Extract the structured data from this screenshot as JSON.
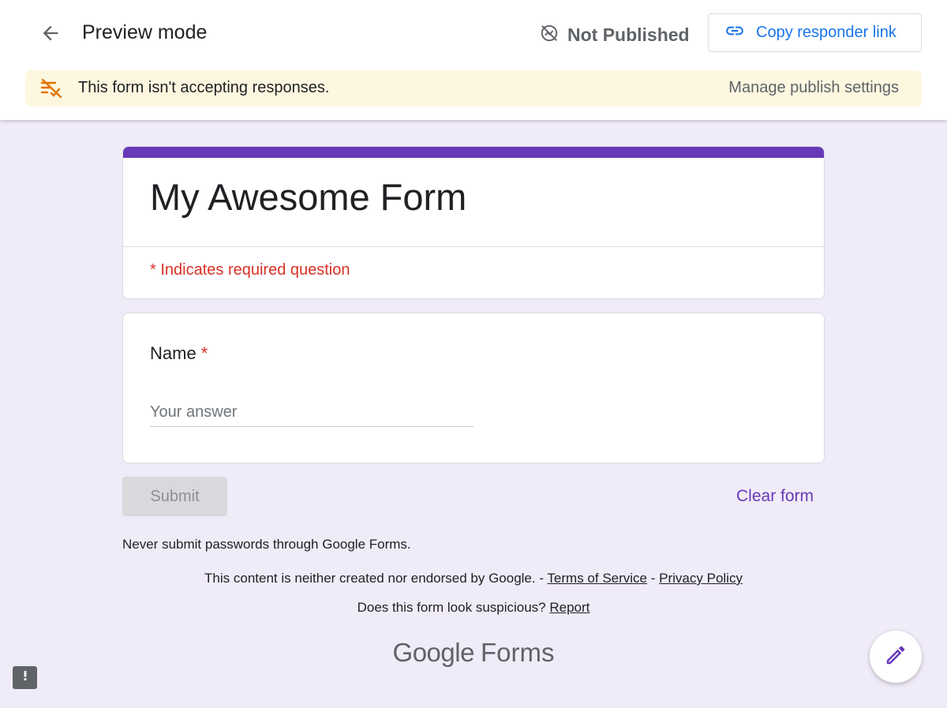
{
  "header": {
    "title": "Preview mode",
    "status_label": "Not Published",
    "copy_link_label": "Copy responder link",
    "icons": {
      "back": "arrow-back-icon",
      "status": "visibility-off-icon",
      "link": "link-icon"
    }
  },
  "banner": {
    "message": "This form isn't accepting responses.",
    "action_label": "Manage publish settings",
    "icon": "not-accepting-responses-icon"
  },
  "form": {
    "title": "My Awesome Form",
    "required_note": "* Indicates required question",
    "questions": [
      {
        "label": "Name",
        "required_marker": "*",
        "placeholder": "Your answer",
        "value": ""
      }
    ],
    "submit_label": "Submit",
    "clear_label": "Clear form"
  },
  "footer": {
    "password_warning": "Never submit passwords through Google Forms.",
    "disclaimer_text": "This content is neither created nor endorsed by Google. -",
    "terms_label": "Terms of Service",
    "separator": "-",
    "privacy_label": "Privacy Policy",
    "suspicious_text": "Does this form look suspicious?",
    "report_label": "Report",
    "brand_google": "Google",
    "brand_forms": "Forms"
  },
  "colors": {
    "accent": "#673ab7",
    "background": "#f0ebf8",
    "link_blue": "#1a73e8",
    "required_red": "#d93025",
    "banner_bg": "#fef7e0",
    "banner_icon": "#e37400"
  },
  "floating": {
    "edit_icon": "pencil-edit-icon",
    "feedback_icon": "feedback-icon"
  }
}
